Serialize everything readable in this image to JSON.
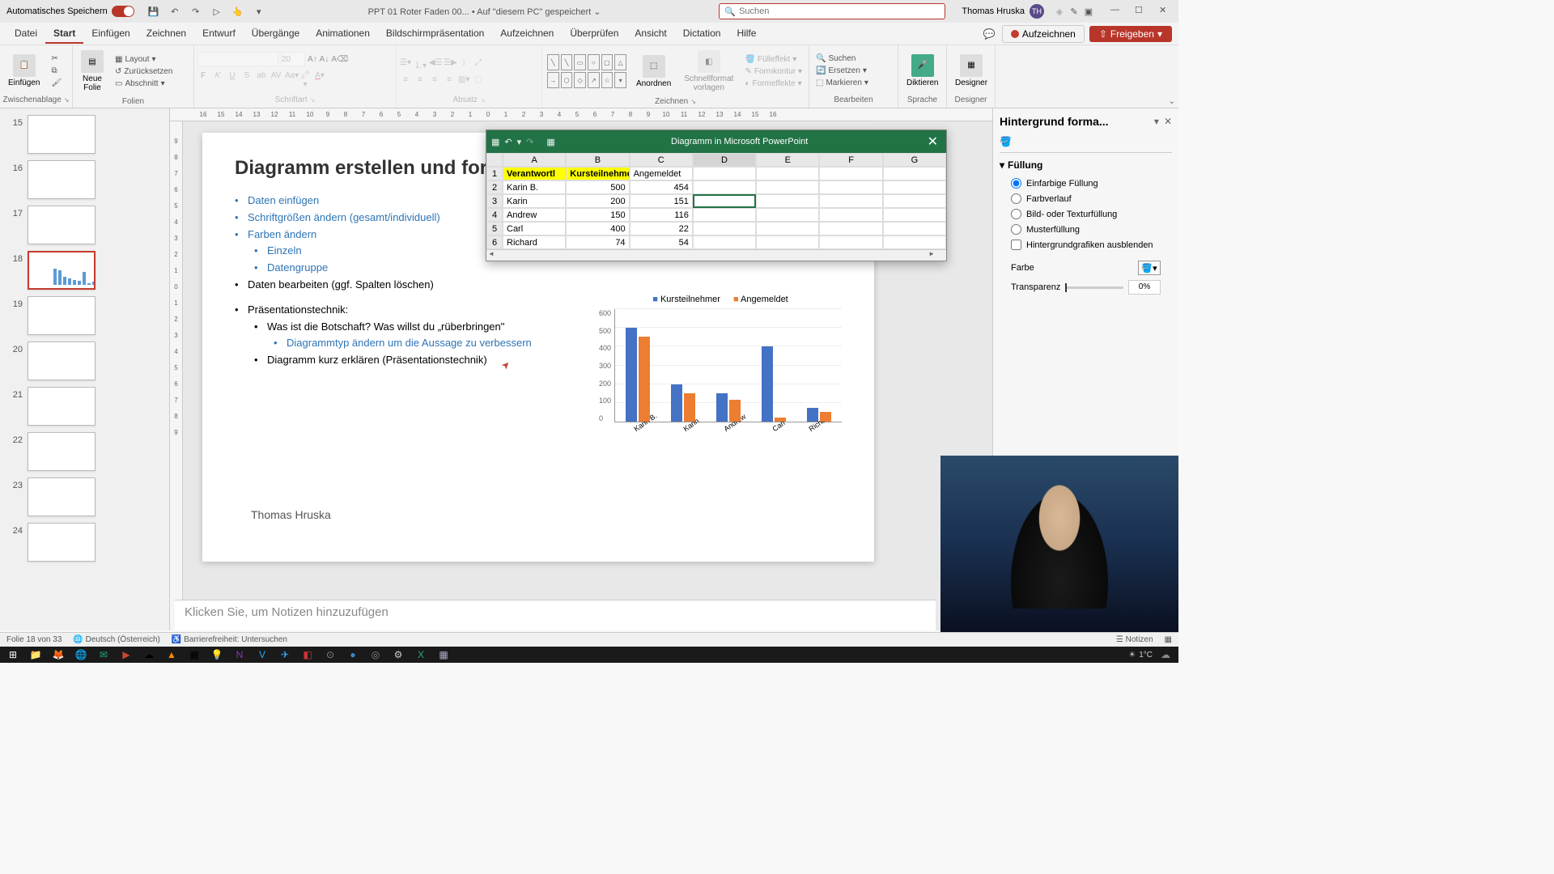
{
  "titlebar": {
    "autosave_label": "Automatisches Speichern",
    "filename": "PPT 01 Roter Faden 00...",
    "saved_location": "• Auf \"diesem PC\" gespeichert",
    "search_placeholder": "Suchen",
    "user_name": "Thomas Hruska",
    "user_initials": "TH"
  },
  "ribbon_tabs": {
    "items": [
      "Datei",
      "Start",
      "Einfügen",
      "Zeichnen",
      "Entwurf",
      "Übergänge",
      "Animationen",
      "Bildschirmpräsentation",
      "Aufzeichnen",
      "Überprüfen",
      "Ansicht",
      "Dictation",
      "Hilfe"
    ],
    "active_index": 1,
    "record_label": "Aufzeichnen",
    "share_label": "Freigeben"
  },
  "ribbon_groups": {
    "clipboard": {
      "label": "Zwischenablage",
      "paste": "Einfügen"
    },
    "slides": {
      "label": "Folien",
      "new_slide": "Neue\nFolie",
      "layout": "Layout",
      "reset": "Zurücksetzen",
      "section": "Abschnitt"
    },
    "font": {
      "label": "Schriftart",
      "font_size": "20"
    },
    "paragraph": {
      "label": "Absatz"
    },
    "drawing": {
      "label": "Zeichnen",
      "arrange": "Anordnen",
      "quick_styles": "Schnellformat\nvorlagen",
      "fill": "Fülleffekt",
      "outline": "Formkontur",
      "effects": "Formeffekte"
    },
    "editing": {
      "label": "Bearbeiten",
      "find": "Suchen",
      "replace": "Ersetzen",
      "select": "Markieren"
    },
    "voice": {
      "label": "Sprache",
      "dictate": "Diktieren"
    },
    "designer": {
      "label": "Designer",
      "designer_btn": "Designer"
    }
  },
  "ruler_h": [
    "16",
    "15",
    "14",
    "13",
    "12",
    "11",
    "10",
    "9",
    "8",
    "7",
    "6",
    "5",
    "4",
    "3",
    "2",
    "1",
    "0",
    "1",
    "2",
    "3",
    "4",
    "5",
    "6",
    "7",
    "8",
    "9",
    "10",
    "11",
    "12",
    "13",
    "14",
    "15",
    "16"
  ],
  "ruler_v": [
    "9",
    "8",
    "7",
    "6",
    "5",
    "4",
    "3",
    "2",
    "1",
    "0",
    "1",
    "2",
    "3",
    "4",
    "5",
    "6",
    "7",
    "8",
    "9"
  ],
  "thumbnails": [
    {
      "num": 15
    },
    {
      "num": 16
    },
    {
      "num": 17
    },
    {
      "num": 18,
      "active": true
    },
    {
      "num": 19
    },
    {
      "num": 20
    },
    {
      "num": 21
    },
    {
      "num": 22
    },
    {
      "num": 23
    },
    {
      "num": 24
    }
  ],
  "slide": {
    "title": "Diagramm erstellen und formati",
    "bullets": [
      {
        "text": "Daten einfügen",
        "cls": "link",
        "lvl": 0
      },
      {
        "text": "Schriftgrößen ändern (gesamt/individuell)",
        "cls": "link",
        "lvl": 0
      },
      {
        "text": "Farben ändern",
        "cls": "link",
        "lvl": 0
      },
      {
        "text": "Einzeln",
        "cls": "link",
        "lvl": 1
      },
      {
        "text": "Datengruppe",
        "cls": "link",
        "lvl": 1
      },
      {
        "text": "Daten bearbeiten (ggf. Spalten löschen)",
        "cls": "",
        "lvl": 0
      }
    ],
    "bullets2_header": "Präsentationstechnik:",
    "bullets2": [
      {
        "text": "Was ist die Botschaft? Was willst du „rüberbringen\"",
        "cls": "",
        "lvl": 1
      },
      {
        "text": "Diagrammtyp ändern um die Aussage zu verbessern",
        "cls": "link",
        "lvl": 2
      },
      {
        "text": "Diagramm kurz erklären (Präsentationstechnik)",
        "cls": "",
        "lvl": 1
      }
    ],
    "author": "Thomas Hruska",
    "notes_placeholder": "Klicken Sie, um Notizen hinzuzufügen"
  },
  "chart_data": {
    "type": "bar",
    "categories": [
      "Karin B.",
      "Karin",
      "Andrew",
      "Carl",
      "Richard"
    ],
    "series": [
      {
        "name": "Kursteilnehmer",
        "values": [
          500,
          200,
          150,
          400,
          74
        ]
      },
      {
        "name": "Angemeldet",
        "values": [
          454,
          151,
          116,
          22,
          54
        ]
      }
    ],
    "ylim": [
      0,
      600
    ],
    "yticks": [
      0,
      100,
      200,
      300,
      400,
      500,
      600
    ],
    "title": "",
    "xlabel": "",
    "ylabel": ""
  },
  "datasheet": {
    "title": "Diagramm in Microsoft PowerPoint",
    "columns": [
      "A",
      "B",
      "C",
      "D",
      "E",
      "F",
      "G"
    ],
    "rows": [
      {
        "num": 1,
        "cells": [
          "Verantwortl",
          "Kursteilnehme",
          "Angemeldet",
          "",
          "",
          "",
          ""
        ],
        "yellow_cols": [
          0,
          1
        ]
      },
      {
        "num": 2,
        "cells": [
          "Karin B.",
          "500",
          "454",
          "",
          "",
          "",
          ""
        ]
      },
      {
        "num": 3,
        "cells": [
          "Karin",
          "200",
          "151",
          "",
          "",
          "",
          ""
        ],
        "selected_col": 3
      },
      {
        "num": 4,
        "cells": [
          "Andrew",
          "150",
          "116",
          "",
          "",
          "",
          ""
        ]
      },
      {
        "num": 5,
        "cells": [
          "Carl",
          "400",
          "22",
          "",
          "",
          "",
          ""
        ]
      },
      {
        "num": 6,
        "cells": [
          "Richard",
          "74",
          "54",
          "",
          "",
          "",
          ""
        ]
      }
    ],
    "active_col_index": 3
  },
  "format_pane": {
    "title": "Hintergrund forma...",
    "section": "Füllung",
    "options": [
      "Einfarbige Füllung",
      "Farbverlauf",
      "Bild- oder Texturfüllung",
      "Musterfüllung"
    ],
    "checkbox": "Hintergrundgrafiken ausblenden",
    "color_label": "Farbe",
    "transparency_label": "Transparenz",
    "transparency_value": "0%"
  },
  "statusbar": {
    "slide_info": "Folie 18 von 33",
    "language": "Deutsch (Österreich)",
    "accessibility": "Barrierefreiheit: Untersuchen",
    "notes_btn": "Notizen"
  },
  "taskbar": {
    "weather": "1°C"
  }
}
